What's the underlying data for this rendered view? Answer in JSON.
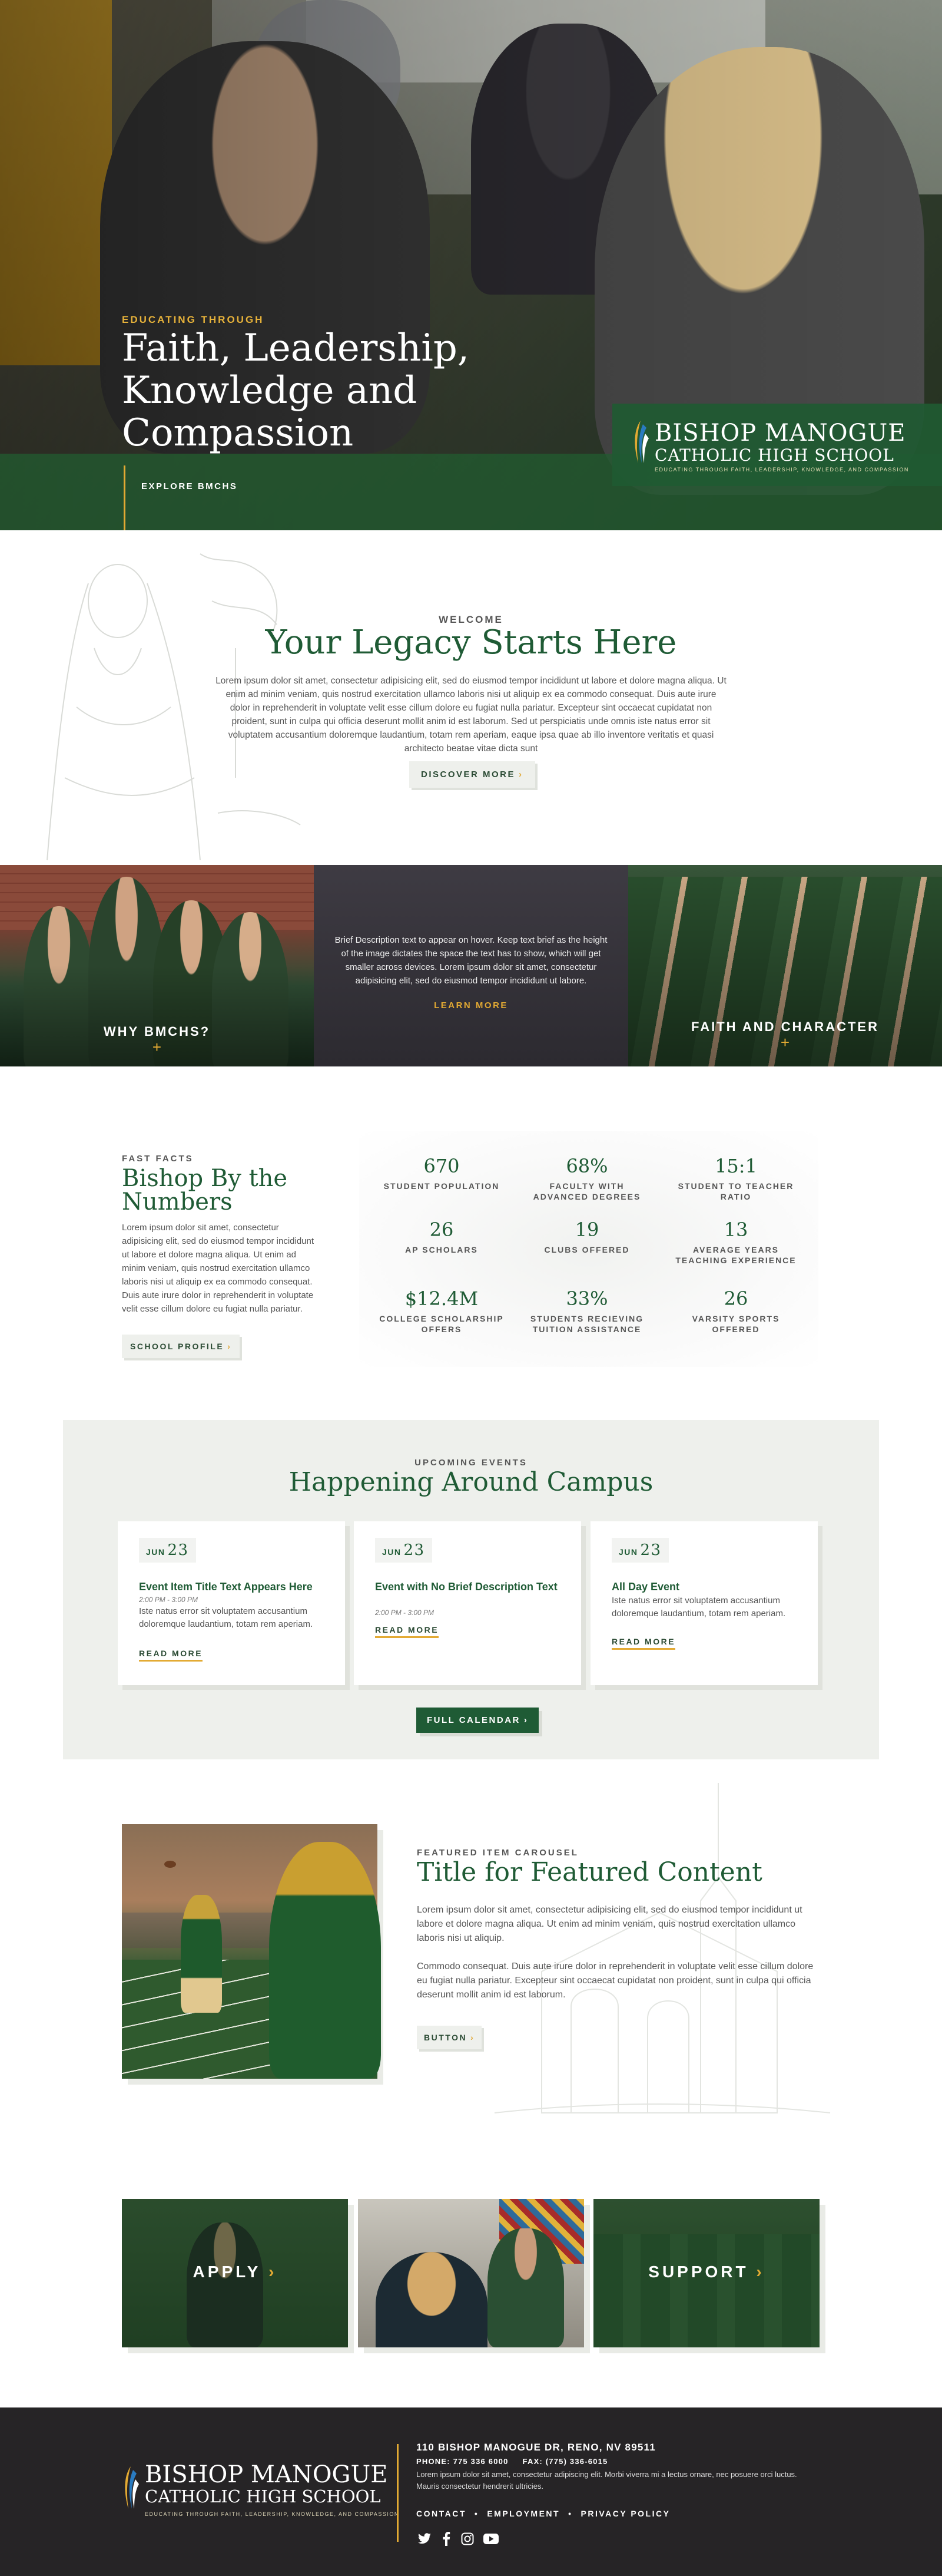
{
  "hero": {
    "eyebrow": "EDUCATING THROUGH",
    "title": "Faith, Leadership, Knowledge and Compassion",
    "link": "EXPLORE BMCHS",
    "school_name_line1": "BISHOP MANOGUE",
    "school_name_line2": "CATHOLIC HIGH SCHOOL",
    "tagline": "EDUCATING THROUGH FAITH, LEADERSHIP, KNOWLEDGE, AND COMPASSION"
  },
  "welcome": {
    "eyebrow": "WELCOME",
    "title": "Your Legacy Starts Here",
    "body": "Lorem ipsum dolor sit amet, consectetur adipisicing elit, sed do eiusmod tempor incididunt ut labore et dolore magna aliqua. Ut enim ad minim veniam, quis nostrud exercitation ullamco laboris nisi ut aliquip ex ea commodo consequat. Duis aute irure dolor in reprehenderit in voluptate velit esse cillum dolore eu fugiat nulla pariatur. Excepteur sint occaecat cupidatat non proident, sunt in culpa qui officia deserunt mollit anim id est laborum. Sed ut perspiciatis unde omnis iste natus error sit voluptatem accusantium doloremque laudantium, totam rem aperiam, eaque ipsa quae ab illo inventore veritatis et quasi architecto beatae vitae dicta sunt",
    "button": "DISCOVER MORE"
  },
  "tiles": {
    "left_label": "WHY BMCHS?",
    "middle_text": "Brief Description text to appear on hover. Keep text brief as the height of the image dictates the space the text has to show, which will get smaller across devices.  Lorem ipsum dolor sit amet, consectetur adipisicing elit, sed do eiusmod tempor incididunt ut labore.",
    "middle_link": "LEARN MORE",
    "right_label": "FAITH AND CHARACTER",
    "plus": "+"
  },
  "facts": {
    "eyebrow": "FAST FACTS",
    "title": "Bishop By the Numbers",
    "body": "Lorem ipsum dolor sit amet, consectetur adipisicing elit, sed do eiusmod tempor incididunt ut labore et dolore magna aliqua. Ut enim ad minim veniam, quis nostrud exercitation ullamco laboris nisi ut aliquip ex ea commodo consequat. Duis aute irure dolor in reprehenderit in voluptate velit esse cillum dolore eu fugiat nulla pariatur.",
    "button": "SCHOOL PROFILE",
    "items": [
      {
        "value": "670",
        "label": "STUDENT POPULATION"
      },
      {
        "value": "68%",
        "label": "FACULTY WITH ADVANCED DEGREES"
      },
      {
        "value": "15:1",
        "label": "STUDENT TO TEACHER RATIO"
      },
      {
        "value": "26",
        "label": "AP SCHOLARS"
      },
      {
        "value": "19",
        "label": "CLUBS OFFERED"
      },
      {
        "value": "13",
        "label": "AVERAGE YEARS TEACHING EXPERIENCE"
      },
      {
        "value": "$12.4M",
        "label": "COLLEGE SCHOLARSHIP OFFERS"
      },
      {
        "value": "33%",
        "label": "STUDENTS RECIEVING TUITION ASSISTANCE"
      },
      {
        "value": "26",
        "label": "VARSITY SPORTS OFFERED"
      }
    ]
  },
  "events": {
    "eyebrow": "UPCOMING EVENTS",
    "title": "Happening Around Campus",
    "button": "FULL CALENDAR",
    "cards": [
      {
        "month": "JUN",
        "day": "23",
        "title": "Event Item Title Text Appears Here",
        "time": "2:00 PM - 3:00 PM",
        "body": "Iste natus error sit voluptatem accusantium doloremque laudantium, totam rem aperiam.",
        "link": "READ MORE"
      },
      {
        "month": "JUN",
        "day": "23",
        "title": "Event with No Brief Description Text",
        "time": "2:00 PM - 3:00 PM",
        "body": "",
        "link": "READ MORE"
      },
      {
        "month": "JUN",
        "day": "23",
        "title": "All Day Event",
        "time": "",
        "body": "Iste natus error sit voluptatem accusantium doloremque laudantium, totam rem aperiam.",
        "link": "READ MORE"
      }
    ]
  },
  "featured": {
    "eyebrow": "FEATURED ITEM CAROUSEL",
    "title": "Title for Featured Content",
    "p1": "Lorem ipsum dolor sit amet, consectetur adipisicing elit, sed do eiusmod tempor incididunt ut labore et dolore magna aliqua. Ut enim ad minim veniam, quis nostrud exercitation ullamco laboris nisi ut aliquip.",
    "p2": "Commodo consequat. Duis aute irure dolor in reprehenderit in voluptate velit esse cillum dolore eu fugiat nulla pariatur. Excepteur sint occaecat cupidatat non proident, sunt in culpa qui officia deserunt mollit anim id est laborum.",
    "button": "BUTTON"
  },
  "cta": {
    "apply": "APPLY",
    "support": "SUPPORT",
    "chev": "›"
  },
  "footer": {
    "school_name_line1": "BISHOP MANOGUE",
    "school_name_line2": "CATHOLIC HIGH SCHOOL",
    "tagline": "EDUCATING THROUGH FAITH, LEADERSHIP, KNOWLEDGE, AND COMPASSION",
    "address": "110 BISHOP MANOGUE DR, RENO, NV 89511",
    "phone": "PHONE: 775 336 6000     FAX: (775) 336-6015",
    "body": "Lorem ipsum dolor sit amet, consectetur adipiscing elit. Morbi viverra mi a lectus ornare, nec posuere orci luctus. Mauris consectetur hendrerit ultricies.",
    "nav": [
      "CONTACT",
      "EMPLOYMENT",
      "PRIVACY POLICY"
    ],
    "nav_sep": "•"
  },
  "colors": {
    "brand_green": "#1f5b35",
    "accent_gold": "#e3aa33",
    "footer_bg": "#262426"
  },
  "icons": [
    "twitter-icon",
    "facebook-icon",
    "instagram-icon",
    "youtube-icon",
    "chevron-right-icon",
    "school-crest-icon"
  ]
}
